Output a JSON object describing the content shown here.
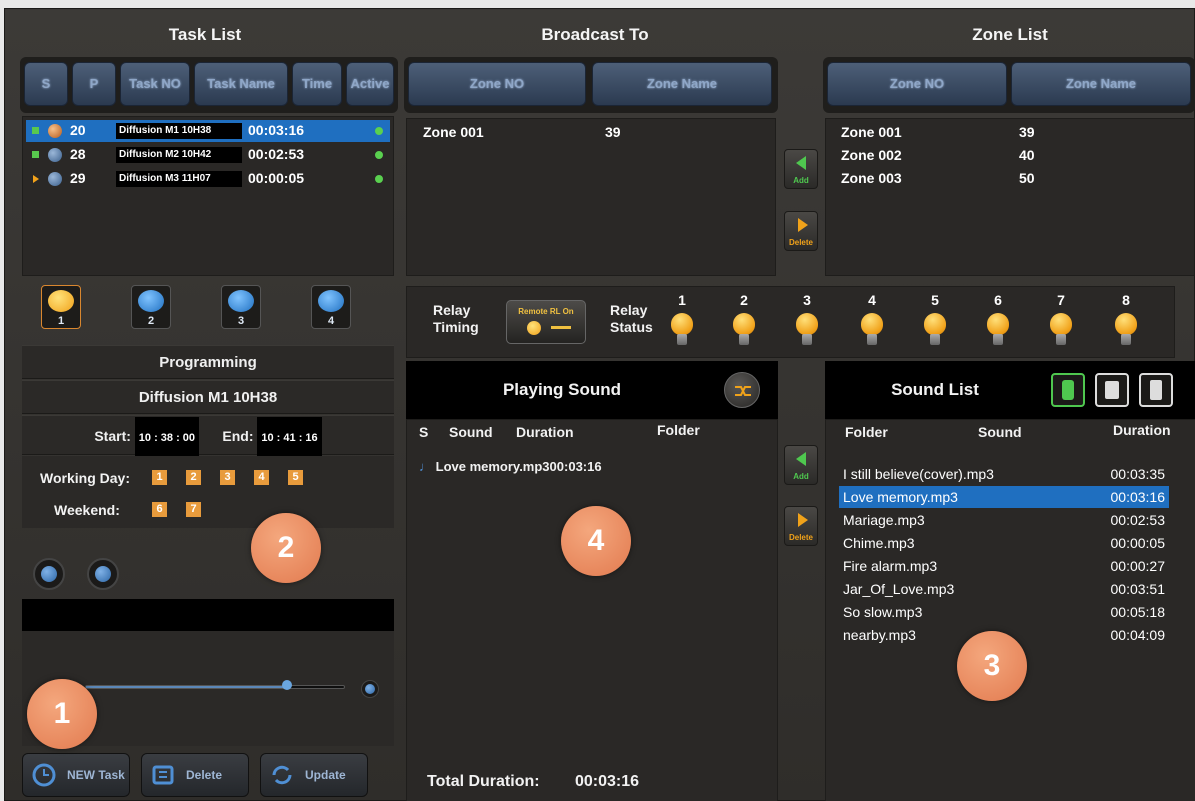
{
  "sections": {
    "task_list": "Task List",
    "broadcast_to": "Broadcast To",
    "zone_list": "Zone List"
  },
  "task_headers": [
    "S",
    "P",
    "Task NO",
    "Task Name",
    "Time",
    "Active"
  ],
  "tasks": [
    {
      "no": "20",
      "name": "Diffusion M1 10H38",
      "time": "00:03:16",
      "selected": true
    },
    {
      "no": "28",
      "name": "Diffusion M2 10H42",
      "time": "00:02:53",
      "selected": false
    },
    {
      "no": "29",
      "name": "Diffusion M3 11H07",
      "time": "00:00:05",
      "selected": false
    }
  ],
  "zone_headers": [
    "Zone NO",
    "Zone Name"
  ],
  "broadcast_zones": [
    {
      "no": "Zone 001",
      "name": "39"
    }
  ],
  "zone_list": [
    {
      "no": "Zone 001",
      "name": "39"
    },
    {
      "no": "Zone 002",
      "name": "40"
    },
    {
      "no": "Zone 003",
      "name": "50"
    }
  ],
  "side_buttons": {
    "add": "Add",
    "delete": "Delete"
  },
  "clocks": [
    "1",
    "2",
    "3",
    "4"
  ],
  "programming": {
    "label": "Programming",
    "task_name": "Diffusion M1 10H38",
    "start_label": "Start:",
    "start_time": "10 : 38 : 00",
    "end_label": "End:",
    "end_time": "10 : 41 : 16",
    "working_day_label": "Working Day:",
    "working_days": [
      "1",
      "2",
      "3",
      "4",
      "5"
    ],
    "weekend_label": "Weekend:",
    "weekend_days": [
      "6",
      "7"
    ]
  },
  "volume_level": 0.78,
  "badges": [
    "1",
    "2",
    "3",
    "4"
  ],
  "bottom_buttons": {
    "new_task": "NEW Task",
    "delete_task": "Delete Task",
    "update": "Update"
  },
  "relay": {
    "timing_label_1": "Relay",
    "timing_label_2": "Timing",
    "remote_label": "Remote RL On",
    "status_label_1": "Relay",
    "status_label_2": "Status",
    "numbers": [
      "1",
      "2",
      "3",
      "4",
      "5",
      "6",
      "7",
      "8"
    ]
  },
  "playing_sound": {
    "title": "Playing Sound",
    "col_s": "S",
    "col_sound": "Sound",
    "col_duration": "Duration",
    "col_folder": "Folder",
    "items": [
      {
        "name": "Love memory.mp3",
        "duration": "00:03:16"
      }
    ],
    "total_label": "Total Duration:",
    "total_value": "00:03:16"
  },
  "sound_list": {
    "title": "Sound List",
    "col_folder": "Folder",
    "col_sound": "Sound",
    "col_duration": "Duration",
    "items": [
      {
        "name": "I still believe(cover).mp3",
        "duration": "00:03:35"
      },
      {
        "name": "Love memory.mp3",
        "duration": "00:03:16"
      },
      {
        "name": "Mariage.mp3",
        "duration": "00:02:53"
      },
      {
        "name": "Chime.mp3",
        "duration": "00:00:05"
      },
      {
        "name": "Fire alarm.mp3",
        "duration": "00:00:27"
      },
      {
        "name": "Jar_Of_Love.mp3",
        "duration": "00:03:51"
      },
      {
        "name": "So slow.mp3",
        "duration": "00:05:18"
      },
      {
        "name": "nearby.mp3",
        "duration": "00:04:09"
      }
    ],
    "selected_index": 1
  },
  "colors": {
    "selection": "#1f6fc0",
    "accent_orange": "#e89b3c",
    "badge": "#e27a4f",
    "header_btn": "#3b4d66"
  }
}
